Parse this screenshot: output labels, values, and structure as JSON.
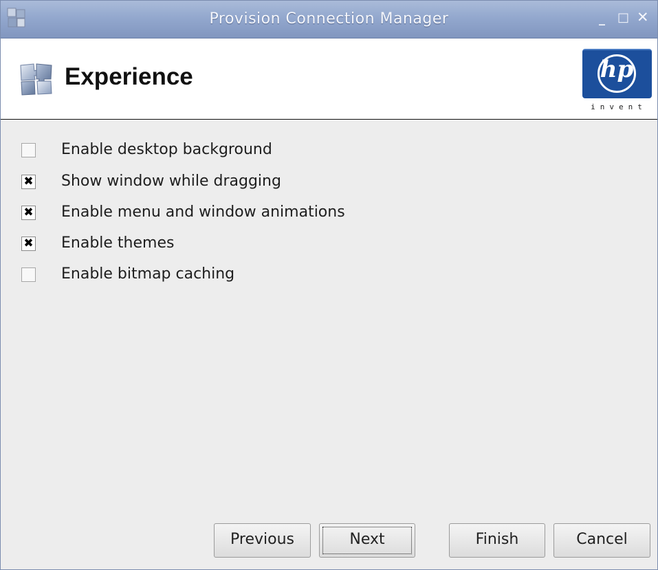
{
  "window": {
    "title": "Provision Connection Manager",
    "controls": {
      "minimize": "_",
      "maximize": "□",
      "close": "✕"
    }
  },
  "header": {
    "title": "Experience",
    "logo": {
      "mark": "hp",
      "tagline": "invent",
      "color": "#1c4f9c"
    }
  },
  "options": [
    {
      "label": "Enable desktop background",
      "checked": false
    },
    {
      "label": "Show window while dragging",
      "checked": true
    },
    {
      "label": "Enable menu and window animations",
      "checked": true
    },
    {
      "label": "Enable themes",
      "checked": true
    },
    {
      "label": "Enable bitmap caching",
      "checked": false
    }
  ],
  "buttons": {
    "previous": "Previous",
    "next": "Next",
    "finish": "Finish",
    "cancel": "Cancel"
  },
  "icons": {
    "app": "puzzle-pieces-icon",
    "page": "puzzle-pieces-icon",
    "checkmark": "✖"
  },
  "colors": {
    "titlebar": "#93a8ce",
    "background": "#ededed",
    "hp_blue": "#1c4f9c"
  }
}
